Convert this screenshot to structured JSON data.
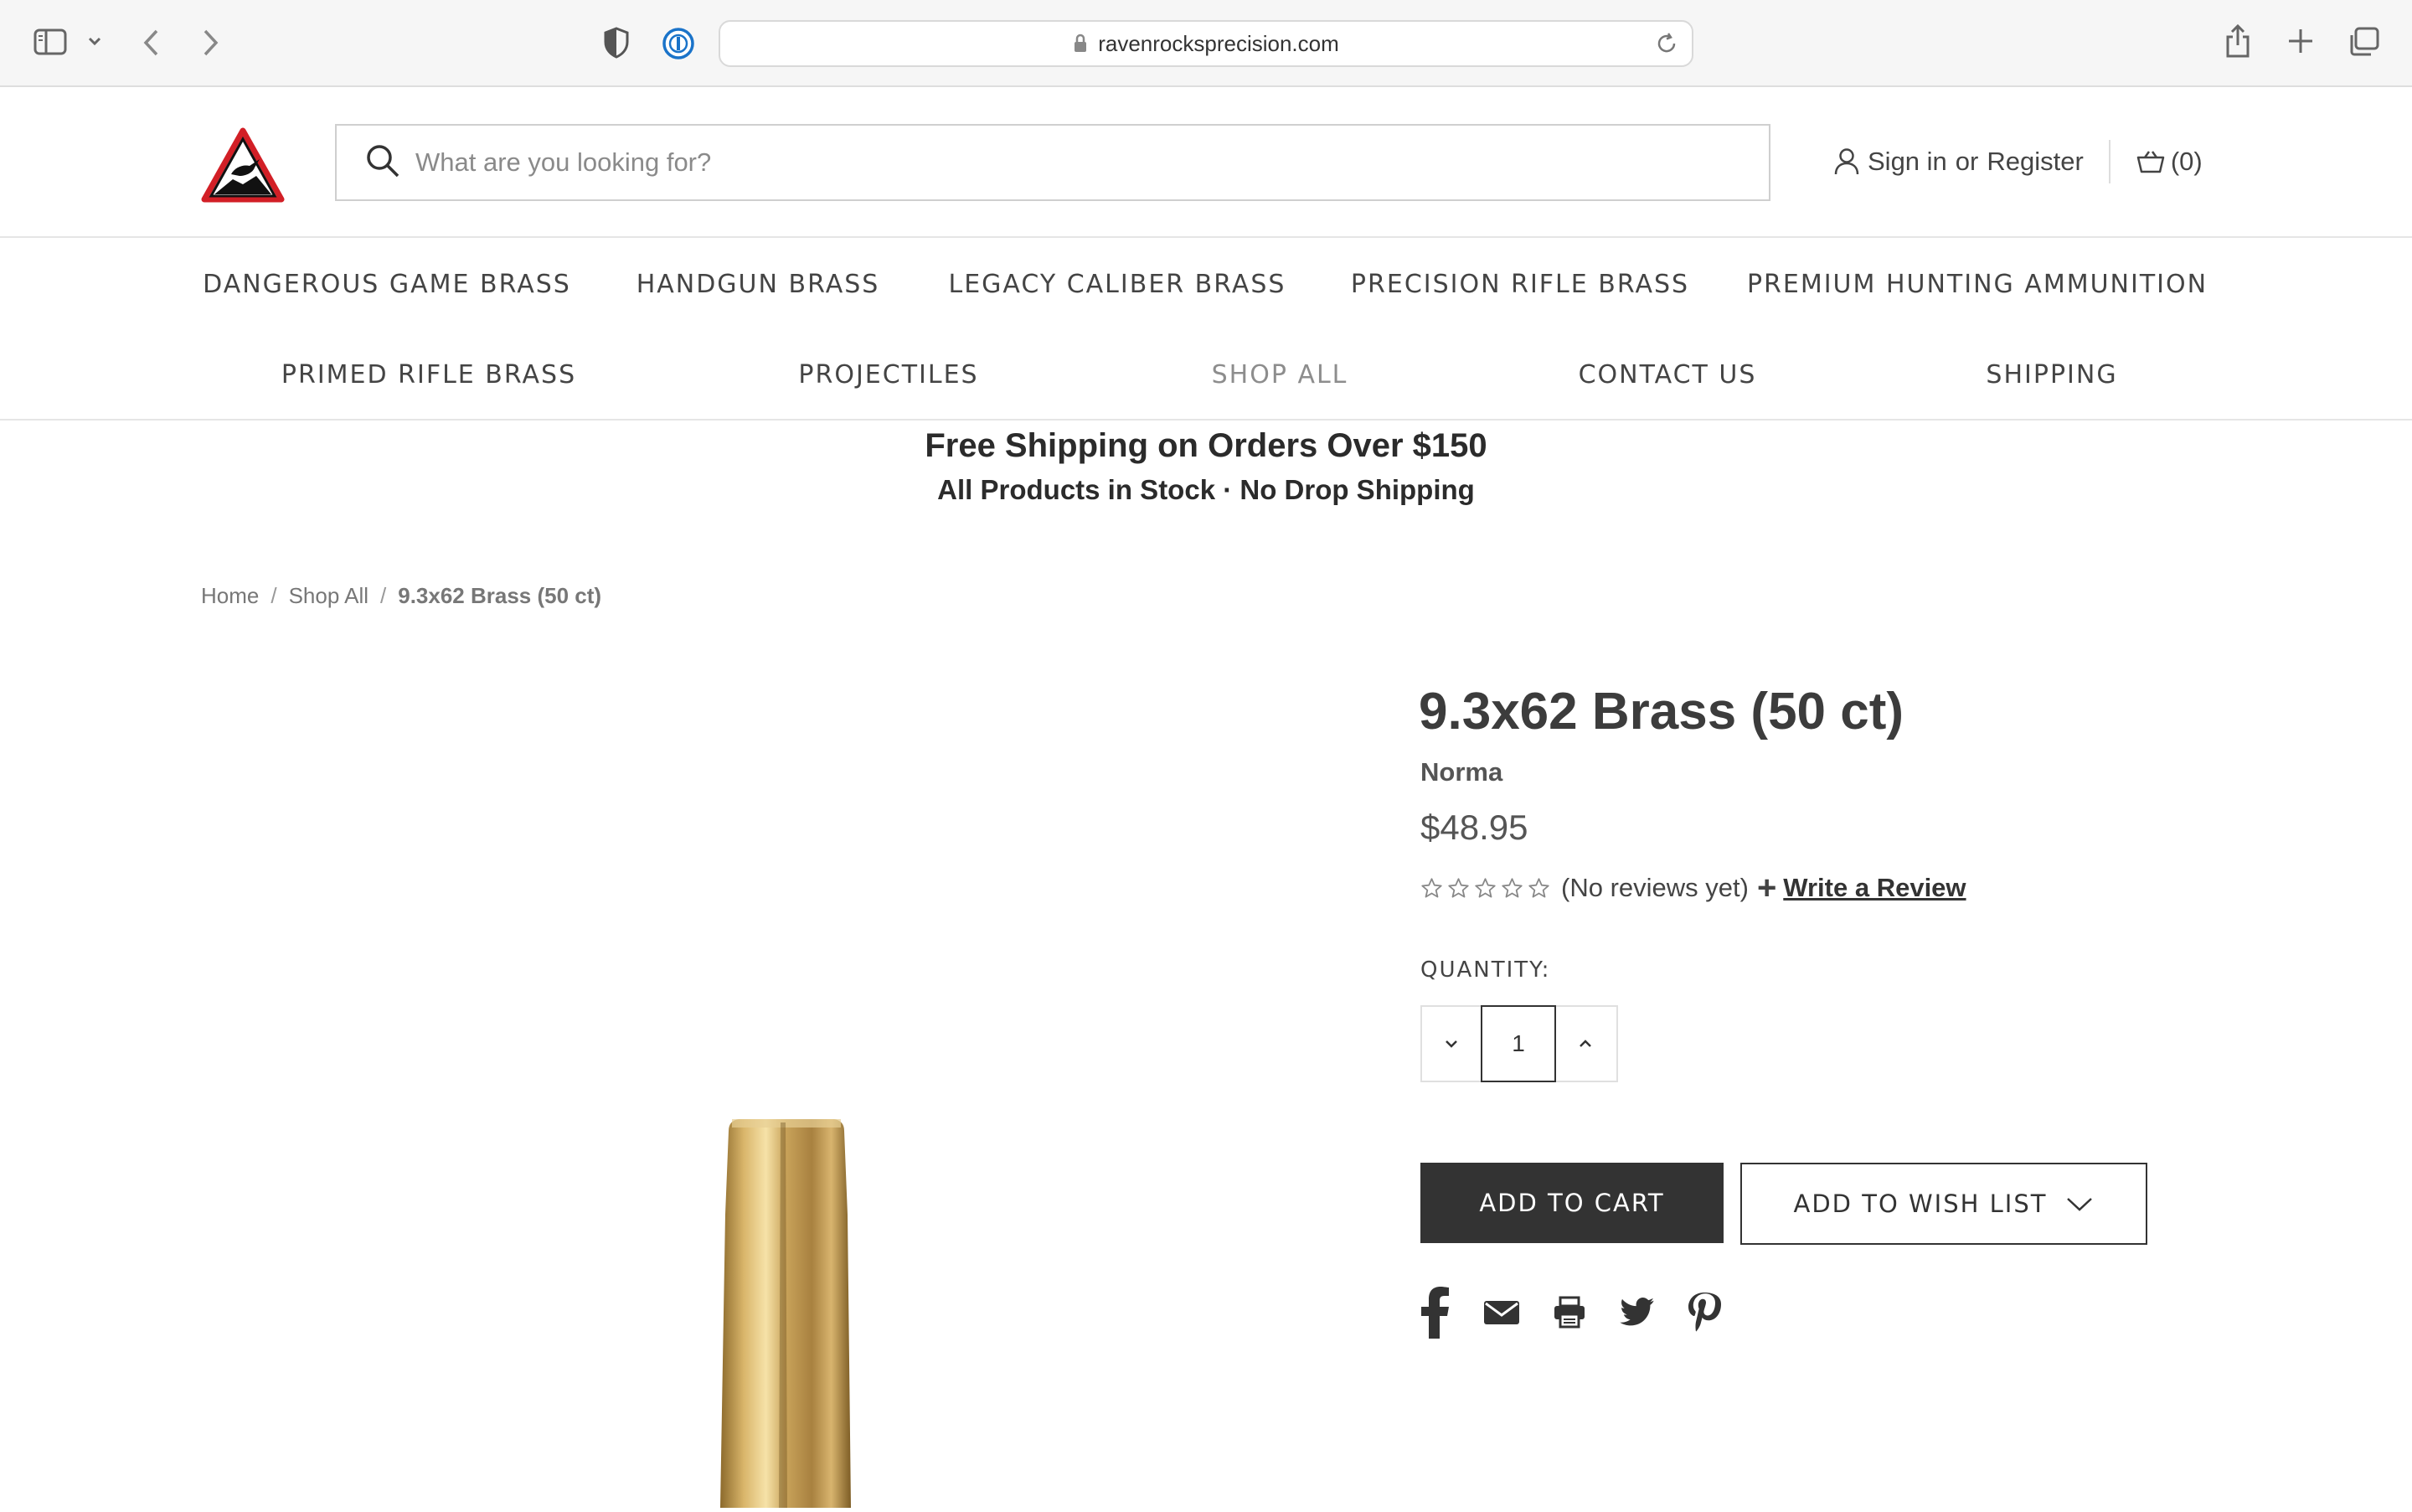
{
  "browser": {
    "url": "ravenrocksprecision.com"
  },
  "header": {
    "search_placeholder": "What are you looking for?",
    "sign_in_label": "Sign in",
    "or_label": "or",
    "register_label": "Register",
    "cart_count": "(0)"
  },
  "nav": {
    "row1": [
      "DANGEROUS GAME BRASS",
      "HANDGUN BRASS",
      "LEGACY CALIBER BRASS",
      "PRECISION RIFLE BRASS",
      "PREMIUM HUNTING AMMUNITION"
    ],
    "row2": [
      "PRIMED RIFLE BRASS",
      "PROJECTILES",
      "SHOP ALL",
      "CONTACT US",
      "SHIPPING"
    ]
  },
  "banner": {
    "line1": "Free Shipping on Orders Over $150",
    "line2": "All Products in Stock · No Drop Shipping"
  },
  "breadcrumb": {
    "items": [
      "Home",
      "Shop All",
      "9.3x62 Brass (50 ct)"
    ],
    "separator": "/"
  },
  "product": {
    "title": "9.3x62 Brass (50 ct)",
    "brand": "Norma",
    "price": "$48.95",
    "rating": 0,
    "rating_max": 5,
    "reviews_text": "(No reviews yet)",
    "plus": "+",
    "write_review": "Write a Review",
    "quantity_label": "QUANTITY:",
    "quantity": "1",
    "add_to_cart": "ADD TO CART",
    "add_to_wish_list": "ADD TO WISH LIST"
  },
  "colors": {
    "primary_button": "#333333",
    "logo_red": "#d21f26",
    "brass": "#c9a35a"
  }
}
